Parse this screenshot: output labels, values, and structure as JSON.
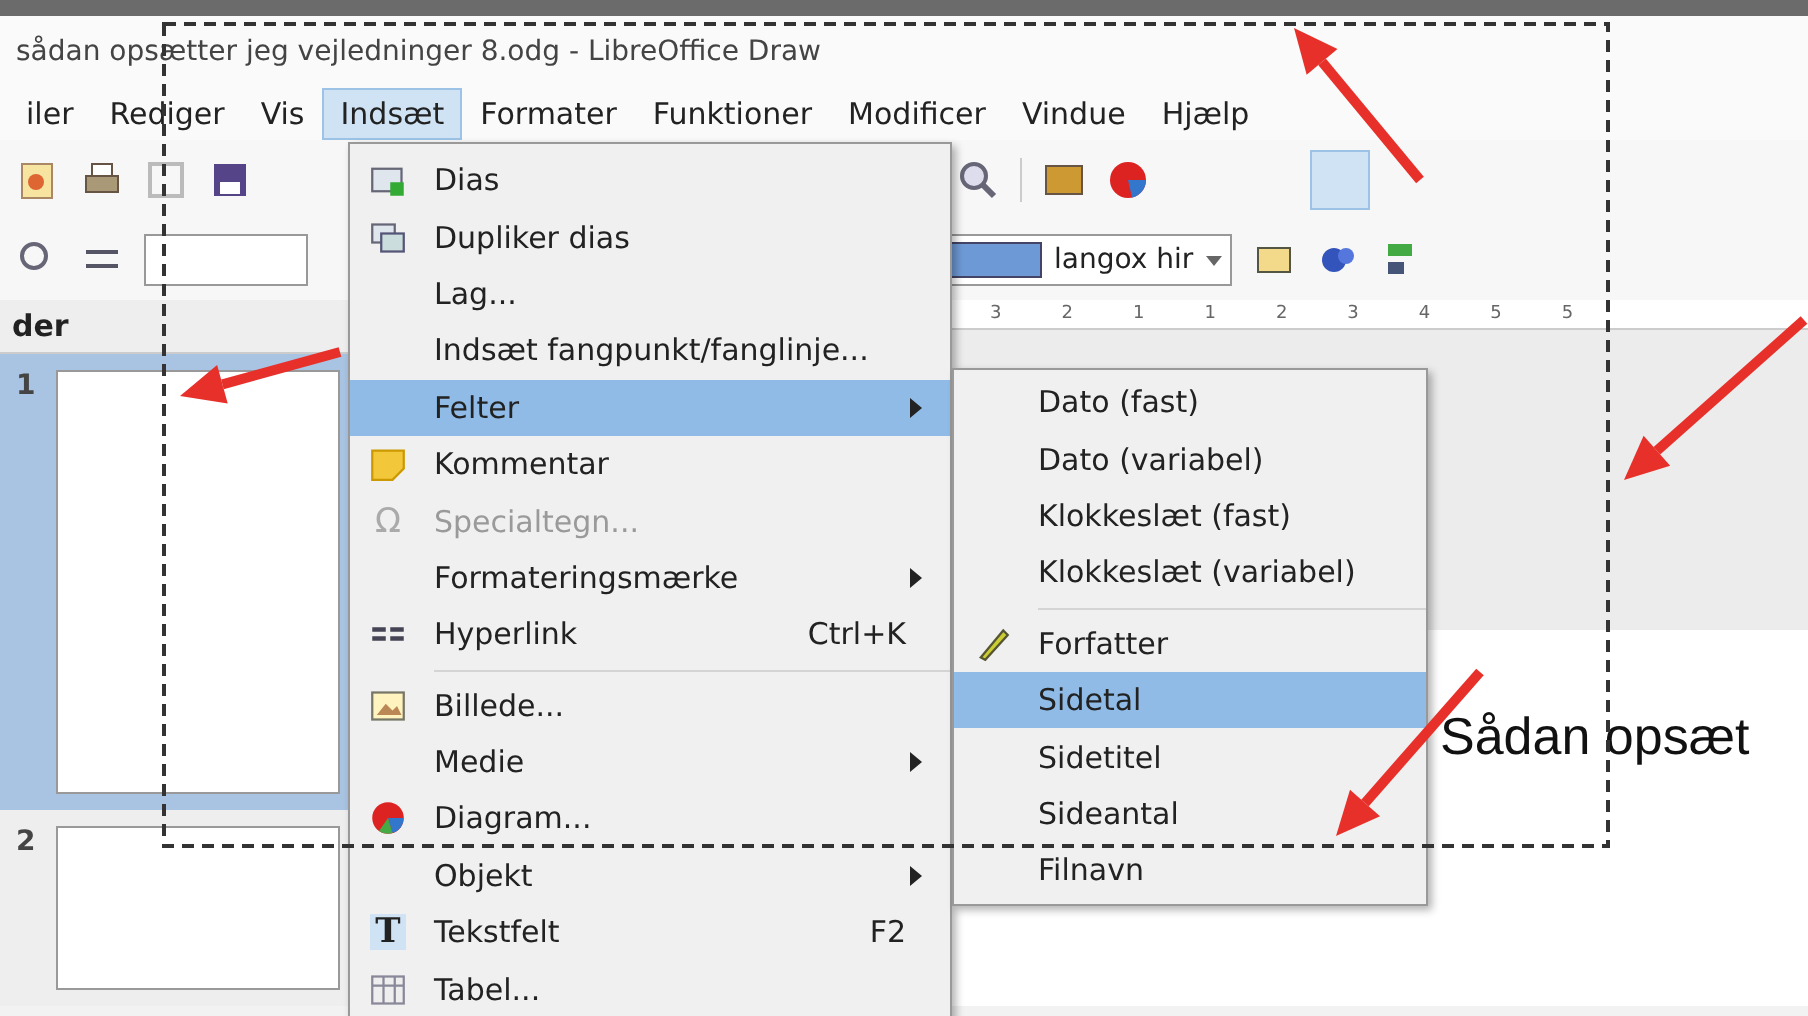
{
  "window": {
    "title": "sådan opsætter jeg vejledninger 8.odg - LibreOffice Draw"
  },
  "menubar": [
    {
      "label": "iler",
      "selected": false
    },
    {
      "label": "Rediger",
      "selected": false
    },
    {
      "label": "Vis",
      "selected": false
    },
    {
      "label": "Indsæt",
      "selected": true
    },
    {
      "label": "Formater",
      "selected": false
    },
    {
      "label": "Funktioner",
      "selected": false
    },
    {
      "label": "Modificer",
      "selected": false
    },
    {
      "label": "Vindue",
      "selected": false
    },
    {
      "label": "Hjælp",
      "selected": false
    }
  ],
  "toolbar": {
    "fill_color_field": "langox hir"
  },
  "ruler": {
    "labels": [
      "3",
      "2",
      "1",
      "1",
      "2",
      "3",
      "4",
      "5",
      "5"
    ]
  },
  "slides_panel": {
    "title": "der",
    "slides": [
      {
        "number": "1",
        "selected": true
      },
      {
        "number": "2",
        "selected": false
      }
    ]
  },
  "canvas": {
    "text": "Sådan opsæt"
  },
  "insert_menu": {
    "items": [
      {
        "label": "Dias",
        "kind": "slide",
        "selected": false,
        "disabled": false
      },
      {
        "label": "Dupliker dias",
        "kind": "duplicate",
        "selected": false,
        "disabled": false
      },
      {
        "label": "Lag...",
        "selected": false,
        "disabled": false
      },
      {
        "label": "Indsæt fangpunkt/fanglinje...",
        "selected": false,
        "disabled": false
      },
      {
        "label": "Felter",
        "submenu": true,
        "selected": true,
        "disabled": false
      },
      {
        "label": "Kommentar",
        "kind": "note",
        "selected": false,
        "disabled": false
      },
      {
        "label": "Specialtegn...",
        "kind": "glyph",
        "glyph": "Ω",
        "selected": false,
        "disabled": true
      },
      {
        "label": "Formateringsmærke",
        "submenu": true,
        "selected": false,
        "disabled": false
      },
      {
        "label": "Hyperlink",
        "kind": "link",
        "shortcut": "Ctrl+K",
        "selected": false,
        "disabled": false,
        "separator_after": true
      },
      {
        "label": "Billede...",
        "kind": "image",
        "selected": false,
        "disabled": false
      },
      {
        "label": "Medie",
        "submenu": true,
        "selected": false,
        "disabled": false
      },
      {
        "label": "Diagram...",
        "kind": "chart",
        "selected": false,
        "disabled": false
      },
      {
        "label": "Objekt",
        "submenu": true,
        "selected": false,
        "disabled": false
      },
      {
        "label": "Tekstfelt",
        "kind": "text",
        "glyph": "T",
        "shortcut": "F2",
        "selected": false,
        "disabled": false
      },
      {
        "label": "Tabel...",
        "kind": "table",
        "selected": false,
        "disabled": false
      }
    ]
  },
  "fields_submenu": {
    "items": [
      {
        "label": "Dato (fast)",
        "selected": false
      },
      {
        "label": "Dato (variabel)",
        "selected": false
      },
      {
        "label": "Klokkeslæt (fast)",
        "selected": false
      },
      {
        "label": "Klokkeslæt (variabel)",
        "selected": false,
        "separator_after": true
      },
      {
        "label": "Forfatter",
        "kind": "pen",
        "selected": false
      },
      {
        "label": "Sidetal",
        "selected": true
      },
      {
        "label": "Sidetitel",
        "selected": false
      },
      {
        "label": "Sideantal",
        "selected": false
      },
      {
        "label": "Filnavn",
        "selected": false
      }
    ]
  }
}
